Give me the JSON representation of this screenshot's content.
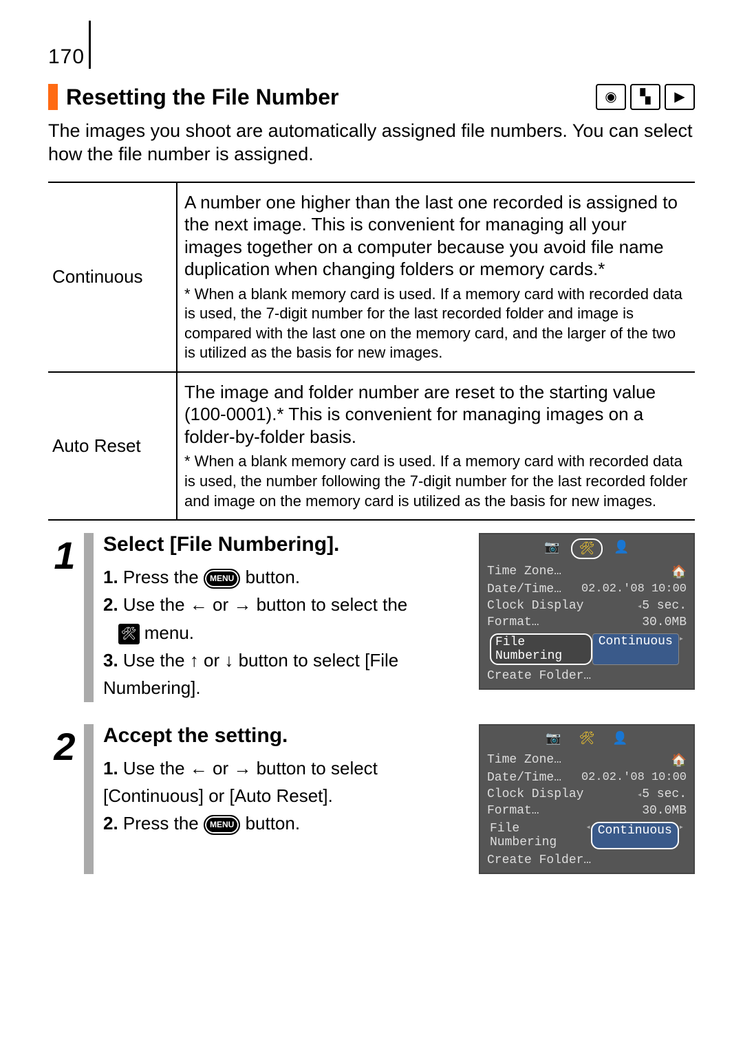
{
  "page_number": "170",
  "section_title": "Resetting the File Number",
  "mode_icons": [
    "camera-icon",
    "video-icon",
    "play-icon"
  ],
  "intro": "The images you shoot are automatically assigned file numbers. You can select how the file number is assigned.",
  "definitions": [
    {
      "term": "Continuous",
      "main": "A number one higher than the last one recorded is assigned to the next image. This is convenient for managing all your images together on a computer because you avoid file name duplication when changing folders or memory cards.*",
      "sub": "* When a blank memory card is used. If a memory card with recorded data is used, the 7-digit number for the last recorded folder and image is compared with the last one on the memory card, and the larger of the two is utilized as the basis for new images."
    },
    {
      "term": "Auto Reset",
      "main": "The image and folder number are reset to the starting value (100-0001).* This is convenient for managing images on a folder-by-folder basis.",
      "sub": "* When a blank memory card is used. If a memory card with recorded data is used, the number following the 7-digit number for the last recorded folder and image on the memory card is utilized as the basis for new images."
    }
  ],
  "steps": [
    {
      "number": "1",
      "title": "Select [File Numbering].",
      "lines": {
        "l1a": "1.",
        "l1b": "Press the ",
        "l1c": " button.",
        "l2a": "2.",
        "l2b": "Use the ",
        "l2c": " or ",
        "l2d": " button to select the ",
        "l2e": " menu.",
        "l3a": "3.",
        "l3b": "Use the ",
        "l3c": " or ",
        "l3d": " button to select [File Numbering]."
      }
    },
    {
      "number": "2",
      "title": "Accept the setting.",
      "lines": {
        "l1a": "1.",
        "l1b": "Use the ",
        "l1c": " or ",
        "l1d": " button to select [Continuous] or [Auto Reset].",
        "l2a": "2.",
        "l2b": "Press the ",
        "l2c": " button."
      }
    }
  ],
  "menu_label": "MENU",
  "camera_menu": {
    "tab_items": [
      "📷",
      "🛠",
      "👤"
    ],
    "rows": [
      {
        "label": "Time Zone…",
        "value": "🏠"
      },
      {
        "label": "Date/Time…",
        "value": "02.02.'08 10:00"
      },
      {
        "label": "Clock Display",
        "value": "5 sec."
      },
      {
        "label": "Format…",
        "value": "30.0MB"
      },
      {
        "label": "File Numbering",
        "value": "Continuous"
      },
      {
        "label": "Create Folder…",
        "value": ""
      }
    ]
  }
}
